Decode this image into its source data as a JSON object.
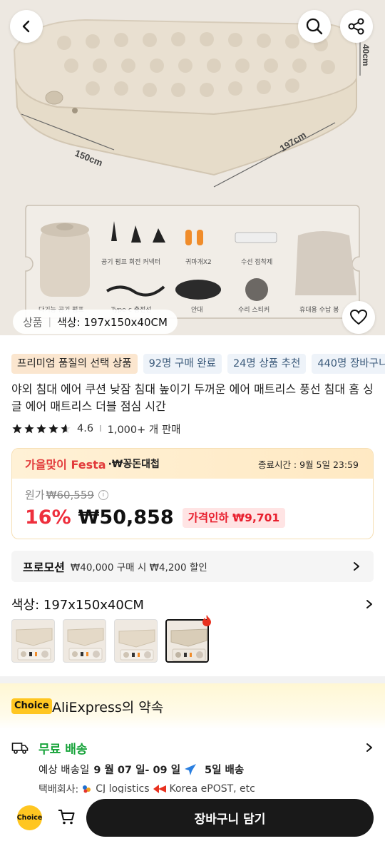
{
  "hero": {
    "dimension_labels": {
      "height": "40cm",
      "width": "150cm",
      "length": "197cm"
    },
    "accessory_labels": [
      "공기 펌프 회전 커넥터",
      "귀마개X2",
      "수선 접착제",
      "Type-c 충전선",
      "안대",
      "수리 스티커",
      "휴대용 수납 봉",
      "다기능 공기 펌프"
    ],
    "variant_chip": {
      "key": "상품",
      "value": "색상: 197x150x40CM"
    }
  },
  "icons": {
    "back": "back-icon",
    "search": "search-icon",
    "share": "share-icon",
    "wishlist": "heart-icon",
    "cart": "cart-icon"
  },
  "tags": [
    "프리미엄 품질의 선택 상품",
    "92명 구매 완료",
    "24명 상품 추천",
    "440명 장바구니 추가"
  ],
  "product": {
    "title": "야외 침대 에어 쿠션 낮잠 침대 높이기 두꺼운 에어 매트리스 풍선 침대 홈 싱글 에어 매트리스 더블 점심 시간",
    "rating": "4.6",
    "rating_value": 4.6,
    "sold": "1,000+ 개 판매"
  },
  "price": {
    "festa": "가을맞이 Festa",
    "festa_sub": "·₩꽁돈대첩",
    "end_time": "종료시간 :  9월 5일 23:59",
    "orig_label": "원가",
    "orig_price": "₩60,559",
    "discount": "16%",
    "sale_price": "₩50,858",
    "price_drop": "가격인하 ₩9,701"
  },
  "promo": {
    "label": "프로모션",
    "text": "₩40,000 구매 시 ₩4,200 할인"
  },
  "color": {
    "label": "색상: 197x150x40CM",
    "selected_index": 3
  },
  "choice": {
    "badge": "Choice",
    "title": "AliExpress의 약속"
  },
  "shipping": {
    "free": "무료 배송",
    "est_label": "예상 배송일",
    "est_dates": "9 월 07 일- 09 일",
    "days": "5일 배송",
    "carrier_label": "택배회사:",
    "carriers": "CJ logistics",
    "carriers2": "Korea ePOST, etc"
  },
  "bottom": {
    "choice_badge": "Choice",
    "add_to_cart": "장바구니 담기"
  },
  "colors": {
    "accent_red": "#ee2f3d",
    "green": "#17a33a",
    "choice_yellow": "#ffc621",
    "dark_button": "#191919"
  }
}
